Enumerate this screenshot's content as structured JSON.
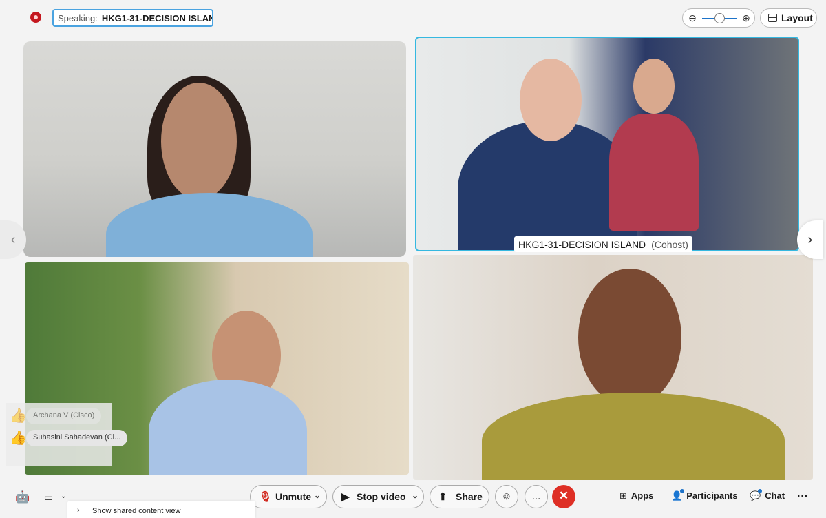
{
  "header": {
    "speaking_label": "Speaking:",
    "speaking_name": "HKG1-31-DECISION ISLAN...",
    "layout_label": "Layout"
  },
  "tiles": {
    "room_name": "HKG1-31-DECISION ISLAND",
    "room_role": "(Cohost)"
  },
  "reactions": [
    {
      "name": "Archana V (Cisco)"
    },
    {
      "name": "Suhasini Sahadevan (Ci..."
    }
  ],
  "controls": {
    "unmute": "Unmute",
    "stop_video": "Stop video",
    "share": "Share",
    "apps": "Apps",
    "participants": "Participants",
    "chat": "Chat",
    "more": "..."
  },
  "popup": {
    "show_shared": "Show shared content view"
  },
  "colors": {
    "accent": "#1d73c9",
    "leave": "#de2f25",
    "active_border": "#35b8e0"
  }
}
